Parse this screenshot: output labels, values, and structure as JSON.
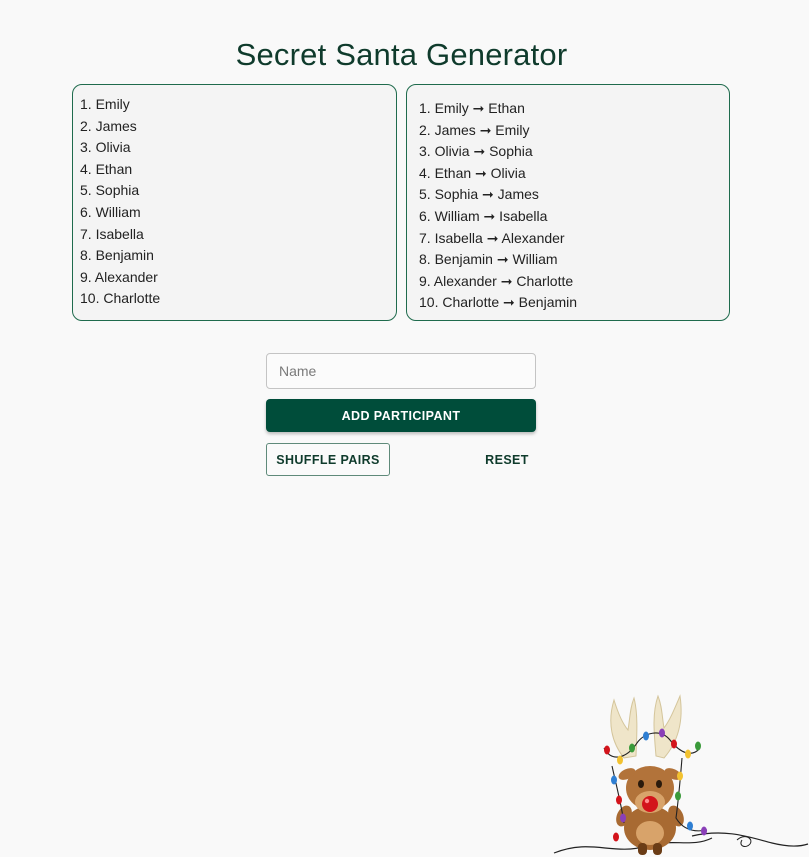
{
  "header": {
    "title": "Secret Santa Generator"
  },
  "participants": [
    "1. Emily",
    "2. James",
    "3. Olivia",
    "4. Ethan",
    "5. Sophia",
    "6. William",
    "7. Isabella",
    "8. Benjamin",
    "9. Alexander",
    "10. Charlotte"
  ],
  "pairs": [
    "1. Emily ➞ Ethan",
    "2. James ➞ Emily",
    "3. Olivia ➞ Sophia",
    "4. Ethan ➞ Olivia",
    "5. Sophia ➞ James",
    "6. William ➞ Isabella",
    "7. Isabella ➞ Alexander",
    "8. Benjamin ➞ William",
    "9. Alexander ➞ Charlotte",
    "10. Charlotte ➞ Benjamin"
  ],
  "form": {
    "name_placeholder": "Name",
    "name_value": "",
    "add_label": "ADD PARTICIPANT",
    "shuffle_label": "SHUFFLE PAIRS",
    "reset_label": "RESET"
  },
  "decoration": {
    "icon": "reindeer-with-christmas-lights-icon"
  },
  "colors": {
    "accent": "#004d3a",
    "title": "#0f3b2c",
    "panel_border": "#1f6b4d",
    "background": "#f9f9f9"
  }
}
